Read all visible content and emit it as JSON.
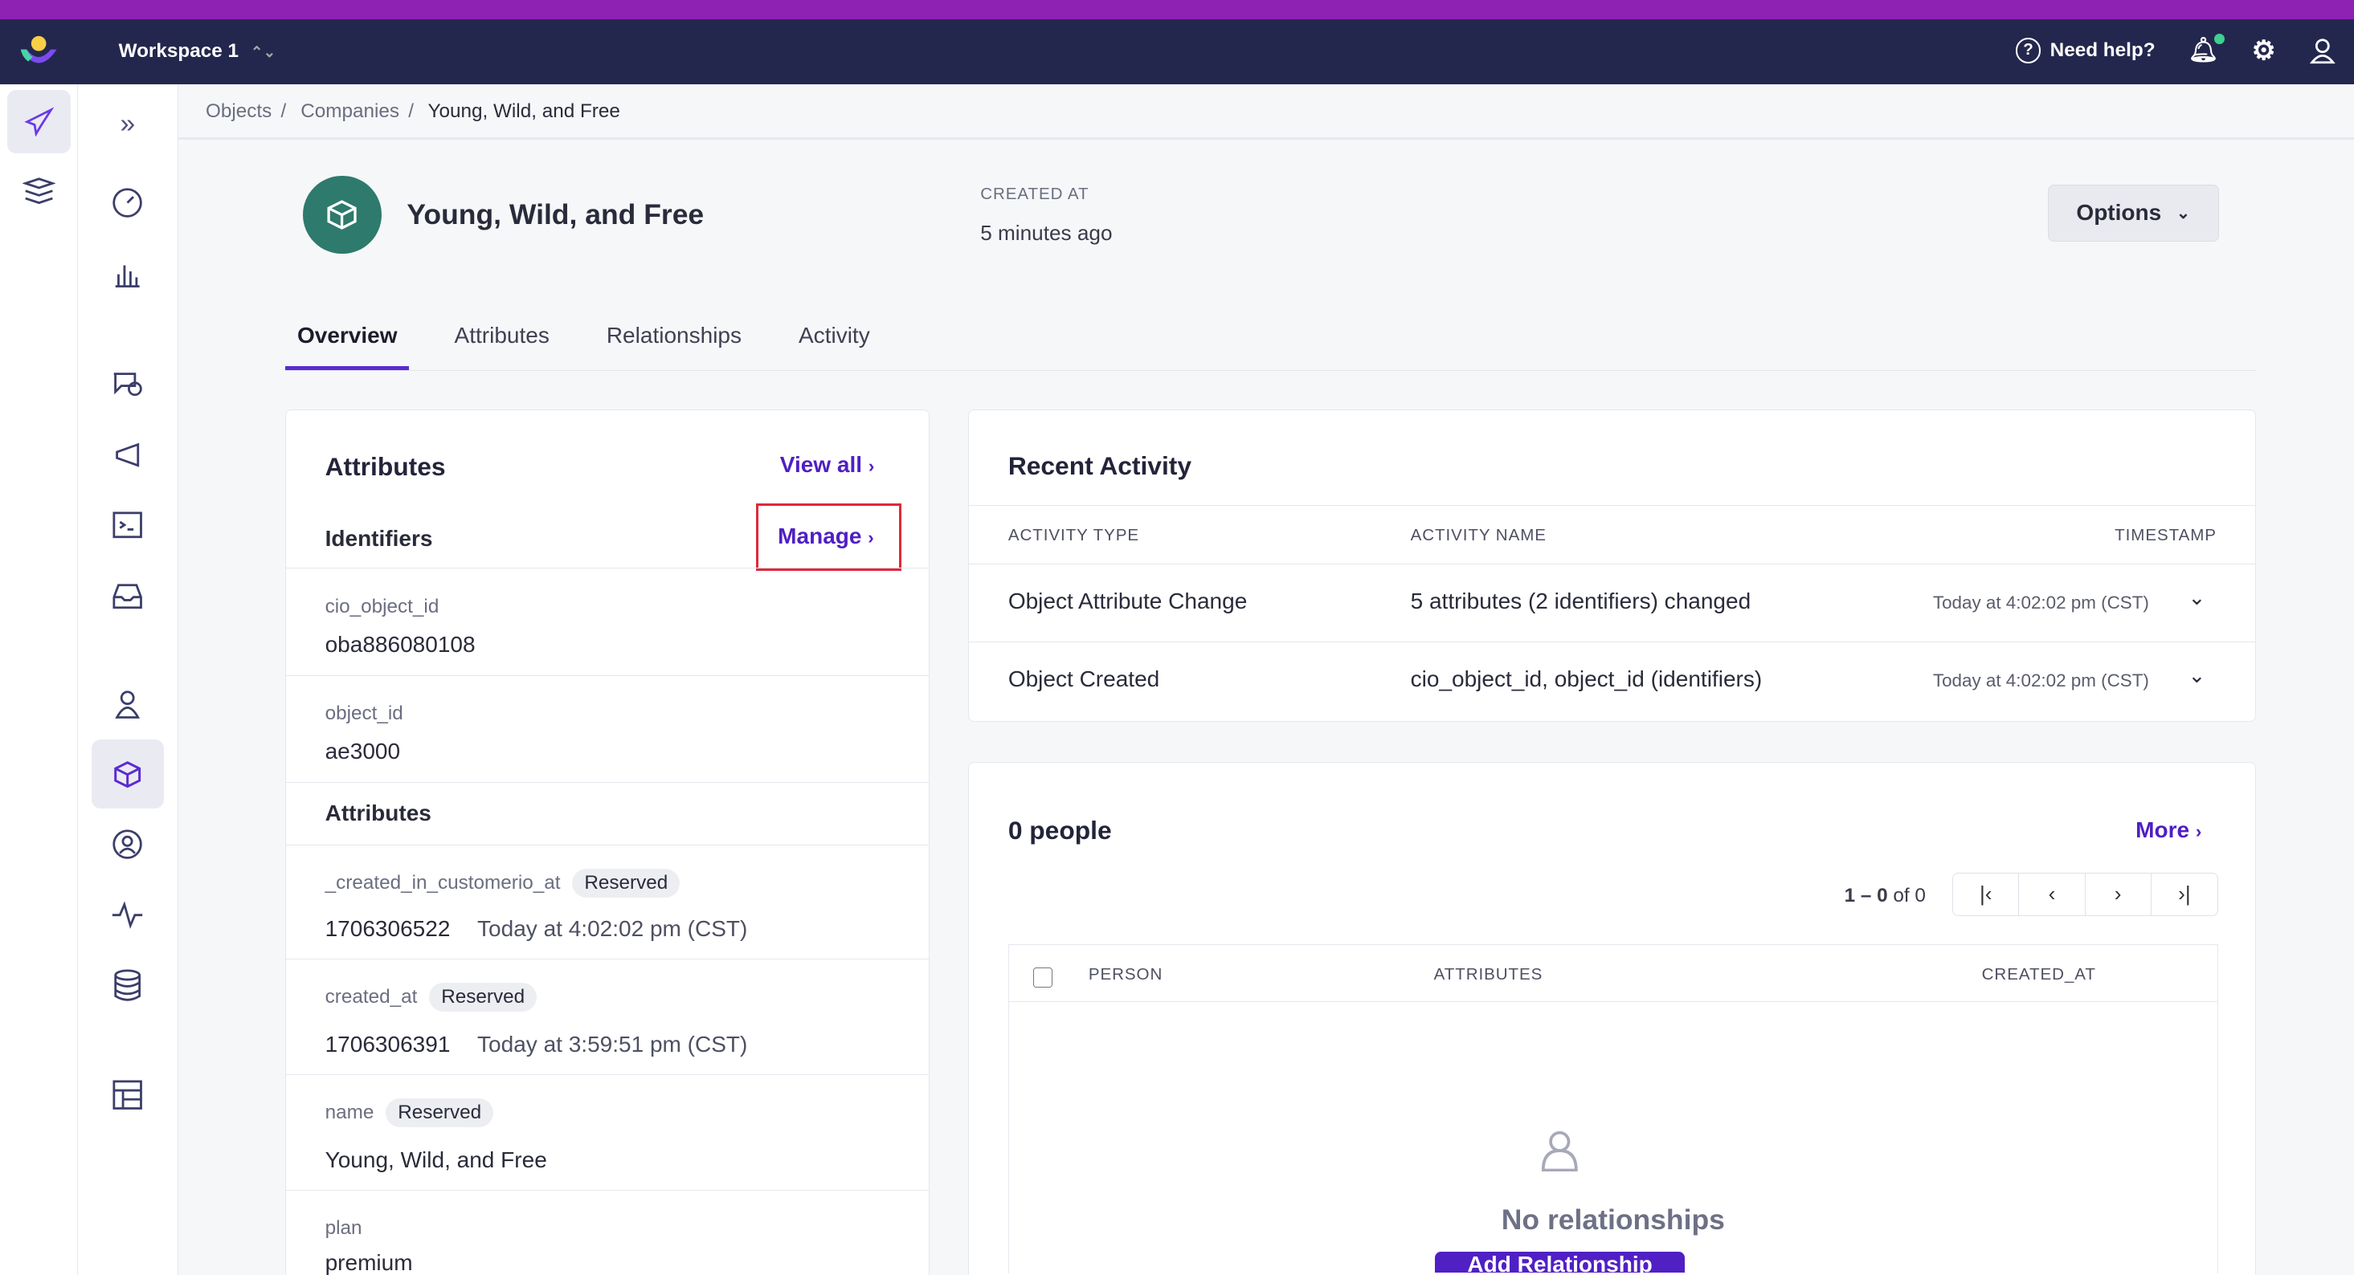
{
  "topbar": {
    "workspace": "Workspace 1",
    "help": "Need help?"
  },
  "breadcrumb": [
    "Objects",
    "Companies",
    "Young, Wild, and Free"
  ],
  "header": {
    "title": "Young, Wild, and Free",
    "created_label": "CREATED AT",
    "created_value": "5 minutes ago",
    "options": "Options"
  },
  "tabs": [
    "Overview",
    "Attributes",
    "Relationships",
    "Activity"
  ],
  "attributes": {
    "title": "Attributes",
    "view_all": "View all",
    "identifiers": "Identifiers",
    "manage": "Manage",
    "ids": [
      {
        "label": "cio_object_id",
        "value": "oba886080108"
      },
      {
        "label": "object_id",
        "value": "ae3000"
      }
    ],
    "attr_heading": "Attributes",
    "items": [
      {
        "label": "_created_in_customerio_at",
        "badge": "Reserved",
        "value": "1706306522",
        "extra": "Today at 4:02:02 pm (CST)"
      },
      {
        "label": "created_at",
        "badge": "Reserved",
        "value": "1706306391",
        "extra": "Today at 3:59:51 pm (CST)"
      },
      {
        "label": "name",
        "badge": "Reserved",
        "value": "Young, Wild, and Free",
        "extra": ""
      },
      {
        "label": "plan",
        "badge": "",
        "value": "premium",
        "extra": ""
      }
    ]
  },
  "activity": {
    "title": "Recent Activity",
    "cols": [
      "ACTIVITY TYPE",
      "ACTIVITY NAME",
      "TIMESTAMP"
    ],
    "rows": [
      {
        "type": "Object Attribute Change",
        "name": "5 attributes (2 identifiers) changed",
        "ts": "Today at 4:02:02 pm (CST)"
      },
      {
        "type": "Object Created",
        "name": "cio_object_id, object_id (identifiers)",
        "ts": "Today at 4:02:02 pm (CST)"
      }
    ]
  },
  "people": {
    "title": "0 people",
    "more": "More",
    "range": "1 – 0",
    "of": "of 0",
    "cols": [
      "PERSON",
      "ATTRIBUTES",
      "CREATED_AT"
    ],
    "empty": "No relationships",
    "add": "Add Relationship"
  }
}
